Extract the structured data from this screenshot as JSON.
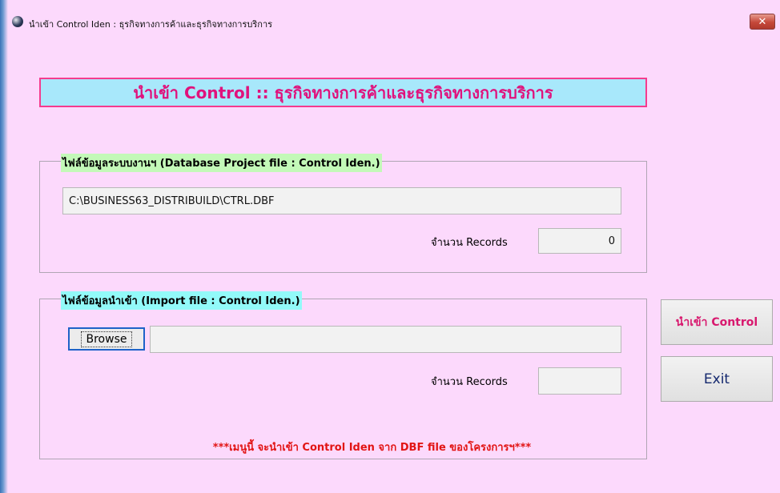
{
  "window": {
    "title": "นำเข้า Control Iden  :  ธุรกิจทางการค้าและธุรกิจทางการบริการ",
    "close_label": "✕"
  },
  "main_title": "นำเข้า Control  ::  ธุรกิจทางการค้าและธุรกิจทางการบริการ",
  "database_group": {
    "legend": "ไฟล์ข้อมูลระบบงานฯ (Database Project file : Control Iden.)",
    "path": "C:\\BUSINESS63_DISTRIBUILD\\CTRL.DBF",
    "records_label": "จำนวน Records",
    "records_value": "0"
  },
  "import_group": {
    "legend": "ไฟล์ข้อมูลนำเข้า (Import file : Control Iden.)",
    "browse_label": "Browse",
    "file_path": "",
    "records_label": "จำนวน Records",
    "records_value": "",
    "note": "***เมนูนี้ จะนำเข้า Control Iden จาก DBF file ของโครงการฯ***"
  },
  "buttons": {
    "import_label": "นำเข้า Control",
    "exit_label": "Exit"
  },
  "colors": {
    "background": "#fcd9fc",
    "title_bg": "#a8e8fb",
    "title_text": "#e0127c",
    "legend_green": "#c3f9b8",
    "legend_cyan": "#92faf9",
    "note_text": "#e21414"
  }
}
